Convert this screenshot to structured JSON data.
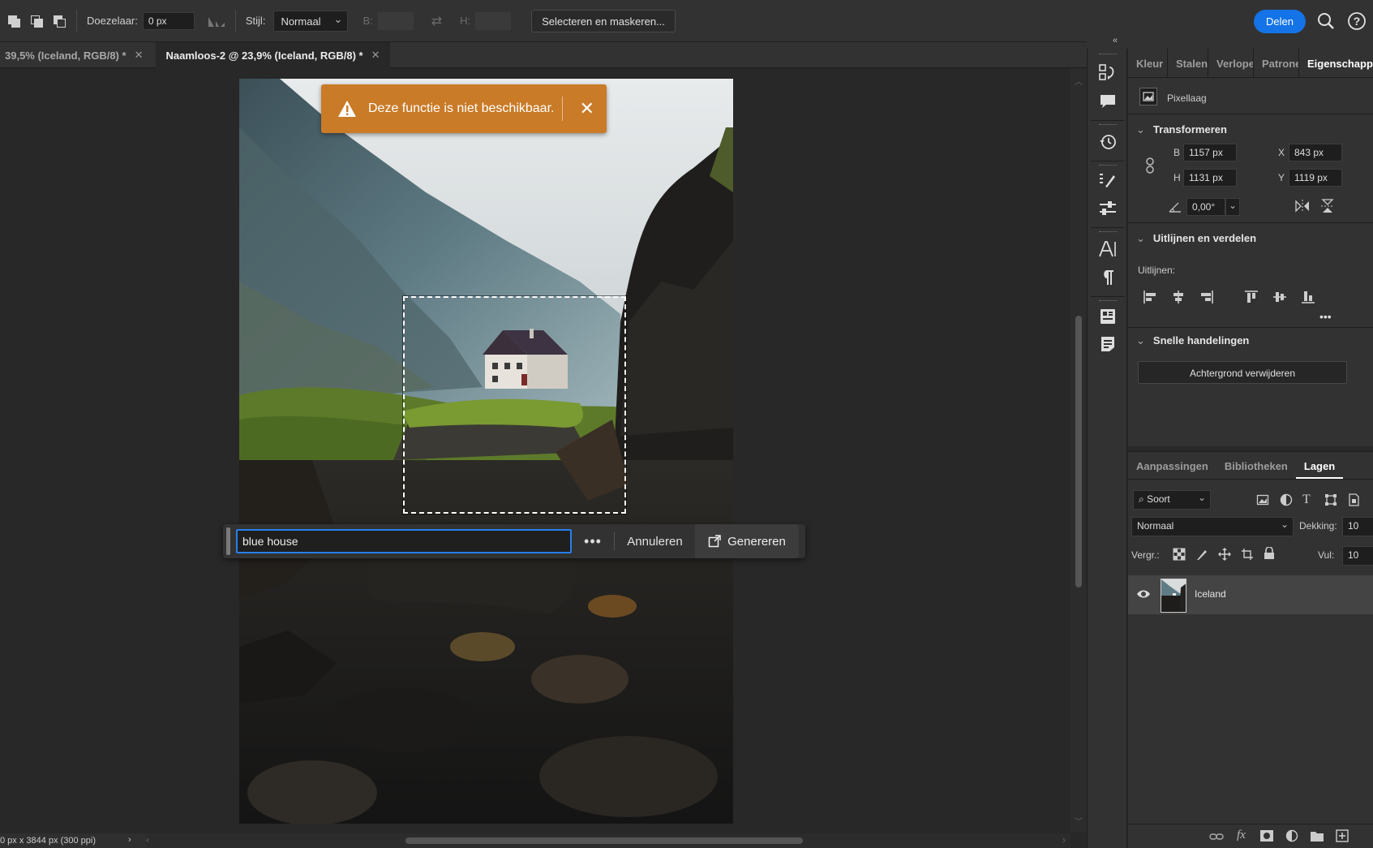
{
  "options_bar": {
    "feather_label": "Doezelaar:",
    "feather_value": "0 px",
    "style_label": "Stijl:",
    "style_value": "Normaal",
    "width_label": "B:",
    "height_label": "H:",
    "select_mask_label": "Selecteren en maskeren...",
    "share_label": "Delen",
    "share_color": "#1473e6"
  },
  "tabs": [
    {
      "label": "39,5% (Iceland, RGB/8) *",
      "active": false
    },
    {
      "label": "Naamloos-2 @ 23,9% (Iceland, RGB/8) *",
      "active": true
    }
  ],
  "toast": {
    "message": "Deze functie is niet beschikbaar.",
    "color": "#c97b28",
    "icon": "warning-icon"
  },
  "generative_bar": {
    "prompt_value": "blue house",
    "more_label": "•••",
    "cancel_label": "Annuleren",
    "generate_label": "Genereren"
  },
  "status_bar": {
    "doc_info": "0 px x 3844 px (300 ppi)"
  },
  "properties": {
    "tabs": [
      "Kleur",
      "Stalen",
      "Verlope",
      "Patrone",
      "Eigenschappen"
    ],
    "active_tab": "Eigenschappen",
    "layer_kind": "Pixellaag",
    "transform_title": "Transformeren",
    "w_label": "B",
    "w_value": "1157 px",
    "h_label": "H",
    "h_value": "1131 px",
    "x_label": "X",
    "x_value": "843 px",
    "y_label": "Y",
    "y_value": "1119 px",
    "angle_value": "0,00°",
    "align_title": "Uitlijnen en verdelen",
    "align_label": "Uitlijnen:",
    "more_label": "•••",
    "quick_title": "Snelle handelingen",
    "remove_bg_label": "Achtergrond verwijderen"
  },
  "layers_panel": {
    "tabs": [
      "Aanpassingen",
      "Bibliotheken",
      "Lagen"
    ],
    "active_tab": "Lagen",
    "filter_label": "Soort",
    "blend_mode": "Normaal",
    "opacity_label": "Dekking:",
    "opacity_value": "10",
    "lock_label": "Vergr.:",
    "fill_label": "Vul:",
    "fill_value": "10",
    "layers": [
      {
        "name": "Iceland",
        "visible": true,
        "selected": true
      }
    ]
  }
}
